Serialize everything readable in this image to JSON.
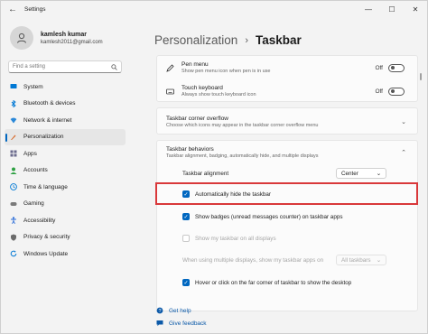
{
  "app": {
    "title": "Settings"
  },
  "window_controls": {
    "minimize": "—",
    "maximize": "☐",
    "close": "✕"
  },
  "profile": {
    "name": "kamlesh kumar",
    "email": "kamlesh2011@gmail.com"
  },
  "search": {
    "placeholder": "Find a setting"
  },
  "sidebar": {
    "items": [
      {
        "label": "System",
        "color": "#0078d4"
      },
      {
        "label": "Bluetooth & devices",
        "color": "#0078d4"
      },
      {
        "label": "Network & internet",
        "color": "#2b88d8"
      },
      {
        "label": "Personalization",
        "color": "#d76a2b"
      },
      {
        "label": "Apps",
        "color": "#6b6b8d"
      },
      {
        "label": "Accounts",
        "color": "#2ea043"
      },
      {
        "label": "Time & language",
        "color": "#0078d4"
      },
      {
        "label": "Gaming",
        "color": "#7a7a7a"
      },
      {
        "label": "Accessibility",
        "color": "#2b6cd8"
      },
      {
        "label": "Privacy & security",
        "color": "#6b6b6b"
      },
      {
        "label": "Windows Update",
        "color": "#0078d4"
      }
    ]
  },
  "breadcrumb": {
    "parent": "Personalization",
    "separator": "›",
    "current": "Taskbar"
  },
  "pen_menu": {
    "title": "Pen menu",
    "subtitle": "Show pen menu icon when pen is in use",
    "state": "Off"
  },
  "touch_keyboard": {
    "title": "Touch keyboard",
    "subtitle": "Always show touch keyboard icon",
    "state": "Off"
  },
  "corner_overflow": {
    "title": "Taskbar corner overflow",
    "subtitle": "Choose which icons may appear in the taskbar corner overflow menu"
  },
  "behaviors": {
    "title": "Taskbar behaviors",
    "subtitle": "Taskbar alignment, badging, automatically hide, and multiple displays",
    "alignment_label": "Taskbar alignment",
    "alignment_value": "Center",
    "auto_hide": "Automatically hide the taskbar",
    "badges": "Show badges (unread messages counter) on taskbar apps",
    "all_displays": "Show my taskbar on all displays",
    "multiple_displays": "When using multiple displays, show my taskbar apps on",
    "multiple_displays_value": "All taskbars",
    "hover_corner": "Hover or click on the far corner of taskbar to show the desktop"
  },
  "help": {
    "get_help": "Get help",
    "give_feedback": "Give feedback"
  }
}
